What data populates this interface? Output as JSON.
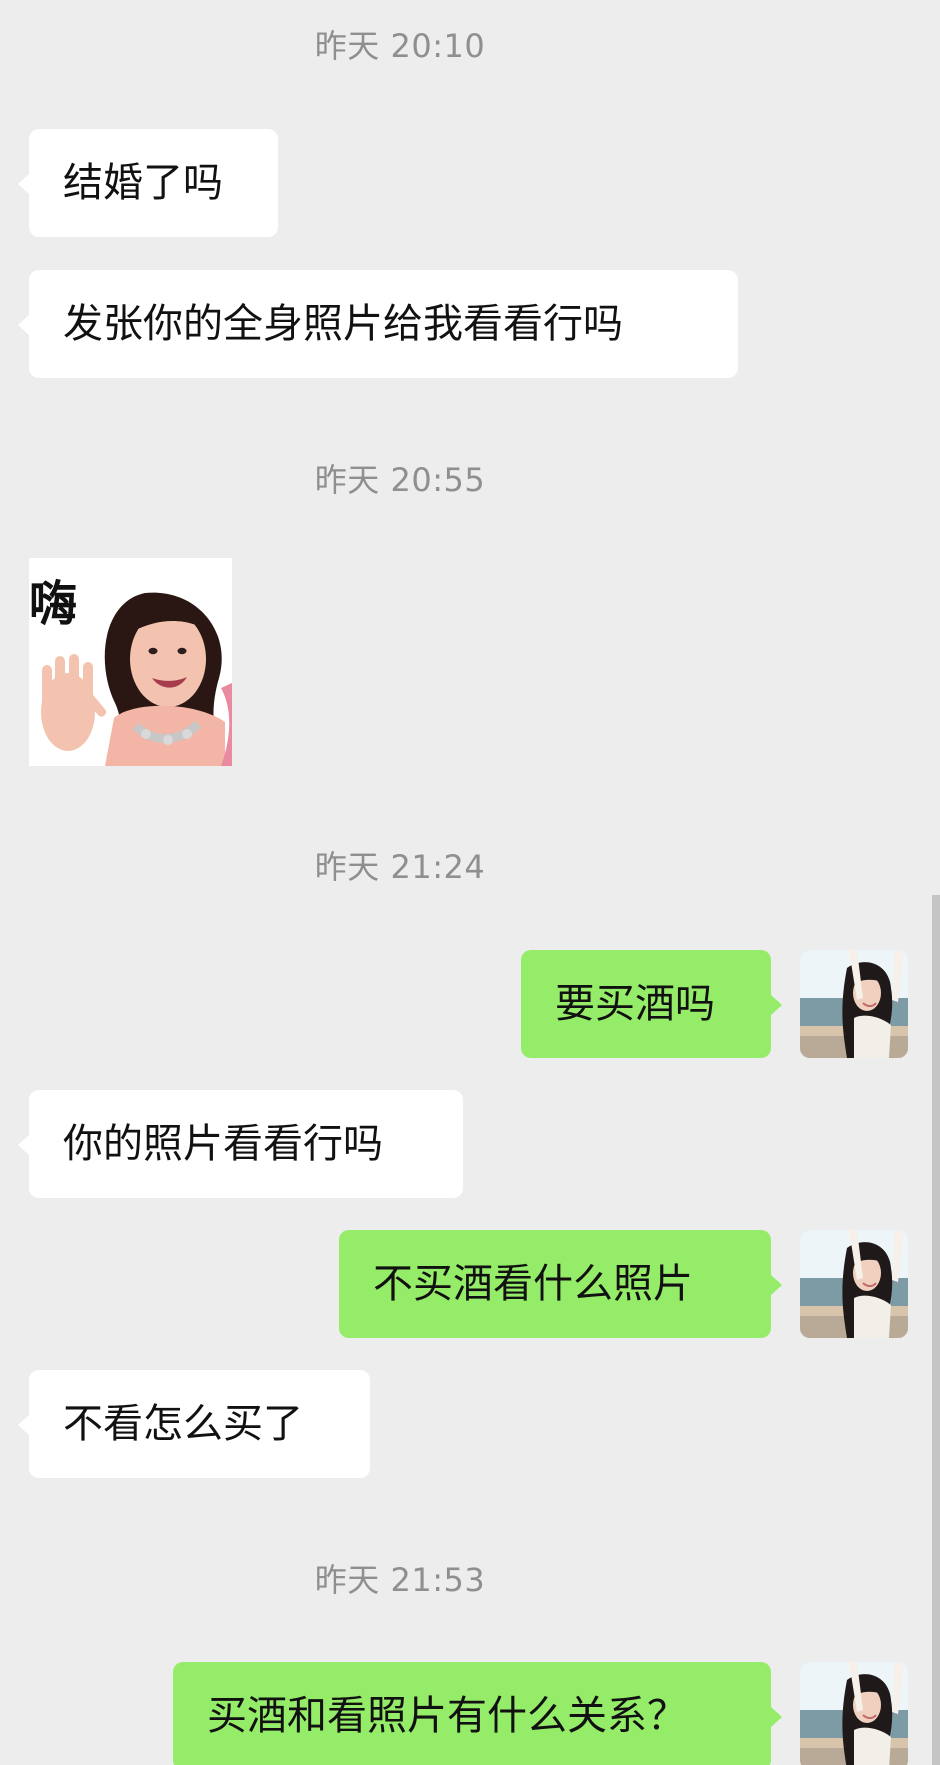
{
  "timestamps": [
    "昨天 20:10",
    "昨天 20:55",
    "昨天 21:24",
    "昨天 21:53"
  ],
  "messages": {
    "m1": "结婚了吗",
    "m2": "发张你的全身照片给我看看行吗",
    "m3": "要买酒吗",
    "m4": "你的照片看看行吗",
    "m5": "不买酒看什么照片",
    "m6": "不看怎么买了",
    "m7": "买酒和看照片有什么关系？"
  },
  "sticker": {
    "text": "嗨"
  },
  "colors": {
    "background": "#ededed",
    "incoming_bubble": "#ffffff",
    "outgoing_bubble": "#95ec69",
    "timestamp_text": "#8f8f8f",
    "message_text": "#111111"
  },
  "icons": {
    "avatar": "self-avatar-photo",
    "sticker": "waving-girl-sticker"
  }
}
